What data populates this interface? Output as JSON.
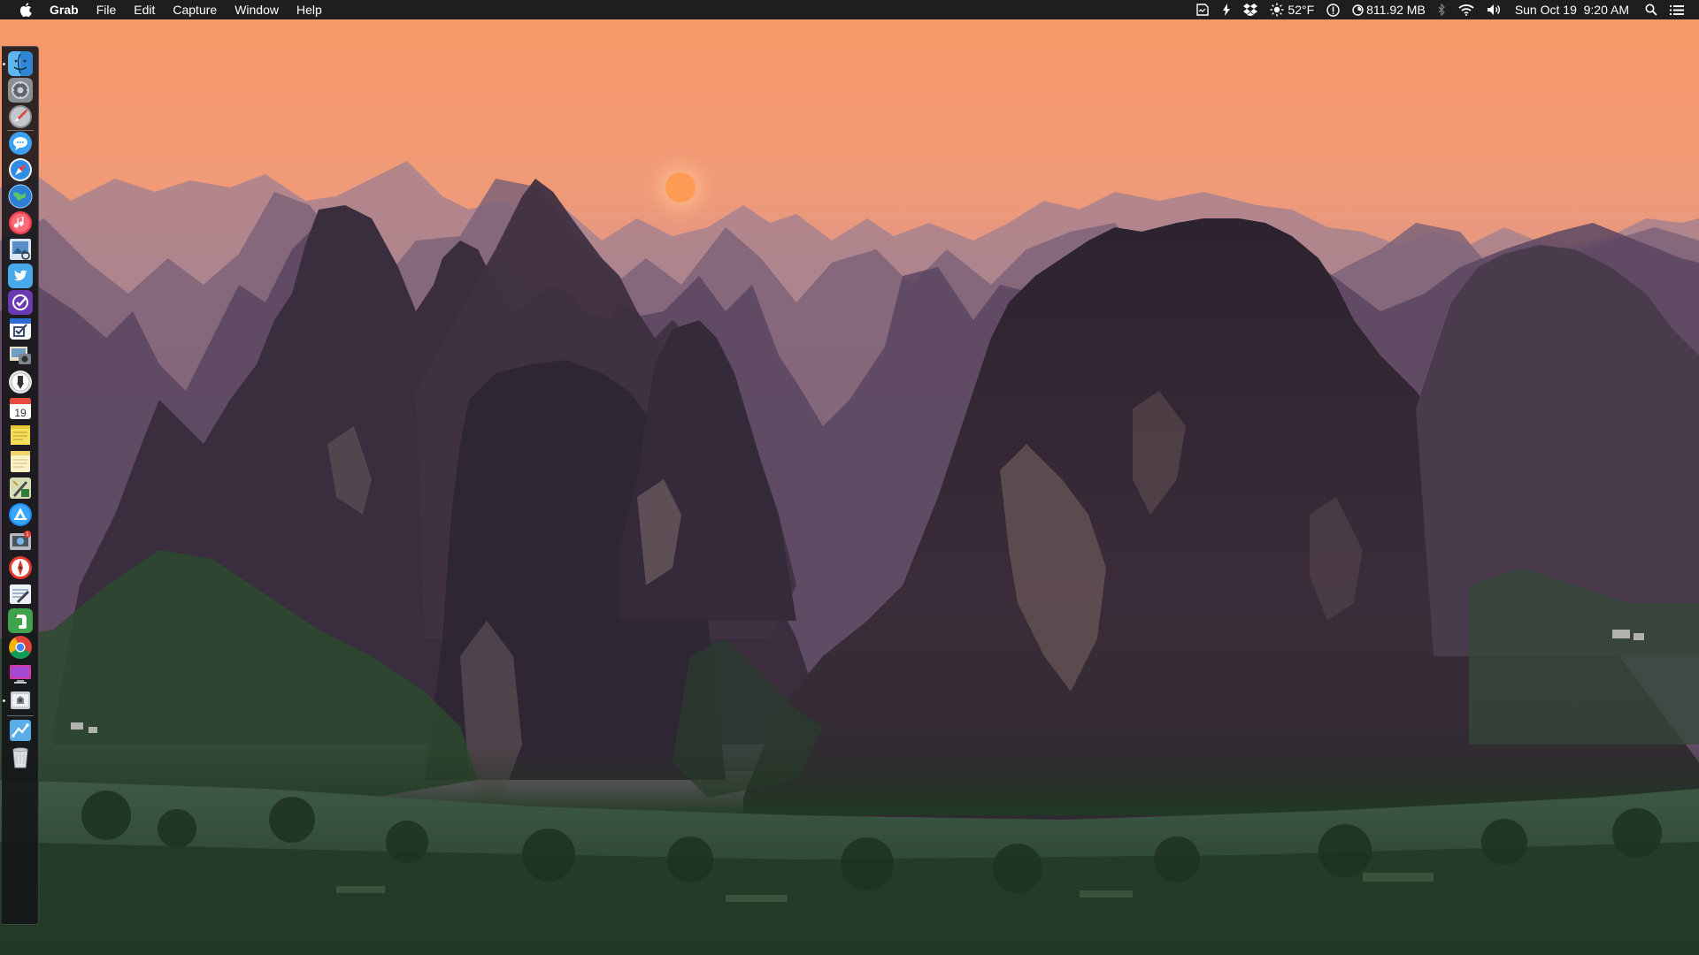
{
  "menubar": {
    "app_name": "Grab",
    "menus": [
      "File",
      "Edit",
      "Capture",
      "Window",
      "Help"
    ],
    "status": {
      "weather": "52°F",
      "memory": "811.92 MB",
      "datetime": "Sun Oct 19  9:20 AM"
    }
  },
  "dock": {
    "items": [
      {
        "icon": "finder-icon",
        "running": true
      },
      {
        "icon": "system-preferences-icon",
        "running": false
      },
      {
        "icon": "launchpad-icon",
        "running": false
      },
      {
        "icon": "messages-icon",
        "running": false
      },
      {
        "icon": "safari-icon",
        "running": false
      },
      {
        "icon": "browser-globe-icon",
        "running": false
      },
      {
        "icon": "itunes-icon",
        "running": false
      },
      {
        "icon": "preview-icon",
        "running": false
      },
      {
        "icon": "twitter-icon",
        "running": false
      },
      {
        "icon": "omnifocus-icon",
        "running": false
      },
      {
        "icon": "things-icon",
        "running": false
      },
      {
        "icon": "image-capture-icon",
        "running": false
      },
      {
        "icon": "pinpoint-icon",
        "running": false
      },
      {
        "icon": "calendar-icon",
        "running": false
      },
      {
        "icon": "stickies-icon",
        "running": false
      },
      {
        "icon": "notes-icon",
        "running": false
      },
      {
        "icon": "script-editor-icon",
        "running": false
      },
      {
        "icon": "app-store-icon",
        "running": false
      },
      {
        "icon": "photo-booth-icon",
        "running": false
      },
      {
        "icon": "compass-app-icon",
        "running": false
      },
      {
        "icon": "textedit-icon",
        "running": false
      },
      {
        "icon": "evernote-icon",
        "running": false
      },
      {
        "icon": "chrome-icon",
        "running": false
      },
      {
        "icon": "desktop-display-icon",
        "running": false
      },
      {
        "icon": "grab-icon",
        "running": true
      },
      {
        "icon": "downloads-stack-icon",
        "running": false
      },
      {
        "icon": "trash-icon",
        "running": false
      }
    ],
    "calendar_day": "19"
  },
  "colors": {
    "menubar_bg": "#1e1e1e",
    "sky_top": "#f79868",
    "sky_bottom": "#b98486",
    "mountain_dark": "#2c2230",
    "valley_green": "#2f4a33",
    "sun": "#ff9a55"
  }
}
